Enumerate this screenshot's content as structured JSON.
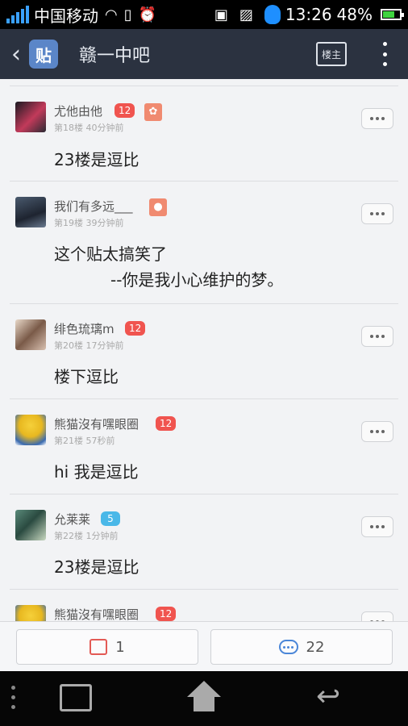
{
  "status_bar": {
    "carrier": "中国移动",
    "time": "13:26",
    "battery": "48%"
  },
  "header": {
    "logo_text": "贴",
    "forum_title": "赣一中吧",
    "louzhu_label": "楼主"
  },
  "posts": [
    {
      "username": "尤他由他",
      "level": "12",
      "floor": "第18楼",
      "time": "40分钟前",
      "text": "23楼是逗比",
      "text2": ""
    },
    {
      "username": "我们有多远___",
      "level": "",
      "floor": "第19楼",
      "time": "39分钟前",
      "text": "这个贴太搞笑了",
      "text2": "--你是我小心维护的梦。"
    },
    {
      "username": "绯色琉璃m",
      "level": "12",
      "floor": "第20楼",
      "time": "17分钟前",
      "text": "楼下逗比",
      "text2": ""
    },
    {
      "username": "熊猫沒有嘿眼圈",
      "level": "12",
      "floor": "第21楼",
      "time": "57秒前",
      "text": "hi 我是逗比",
      "text2": ""
    },
    {
      "username": "允莱莱",
      "level": "5",
      "floor": "第22楼",
      "time": "1分钟前",
      "text": "23楼是逗比",
      "text2": ""
    },
    {
      "username": "熊猫沒有嘿眼圈",
      "level": "12",
      "floor": "",
      "time": "",
      "text": "",
      "text2": ""
    }
  ],
  "actions": {
    "like_count": "1",
    "comment_count": "22"
  },
  "colors": {
    "header_bg": "#2b3240",
    "level_red": "#f0544f",
    "level_blue": "#4ab8e8",
    "content_bg": "#f2f3f5"
  }
}
